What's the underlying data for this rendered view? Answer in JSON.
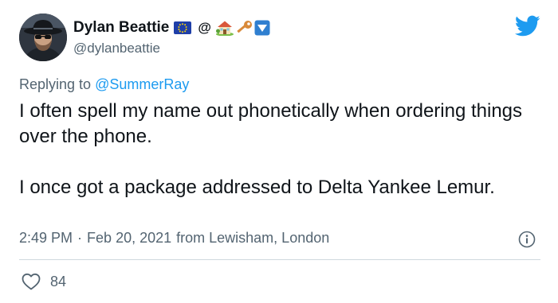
{
  "author": {
    "display_name": "Dylan Beattie",
    "name_emojis": [
      "eu-flag-icon",
      "at-sign-icon",
      "house-with-garden-icon",
      "key-icon",
      "down-triangle-button-icon"
    ],
    "at_sign": "@",
    "handle": "@dylanbeattie",
    "avatar": "avatar"
  },
  "reply": {
    "prefix": "Replying to ",
    "mention": "@SummerRay"
  },
  "body": {
    "paragraph_1": "I often spell my name out phonetically when ordering things over the phone.",
    "paragraph_2": "I once got a package addressed to Delta Yankee Lemur."
  },
  "meta": {
    "time": "2:49 PM",
    "separator": "·",
    "date": "Feb 20, 2021",
    "location": "from Lewisham, London"
  },
  "stats": {
    "likes": "84"
  },
  "icons": {
    "logo": "twitter-bird-icon",
    "info": "info-icon",
    "like": "heart-icon"
  },
  "colors": {
    "brand": "#1d9bf0",
    "text_primary": "#0f1419",
    "text_secondary": "#536471",
    "divider": "#cfd9de"
  }
}
